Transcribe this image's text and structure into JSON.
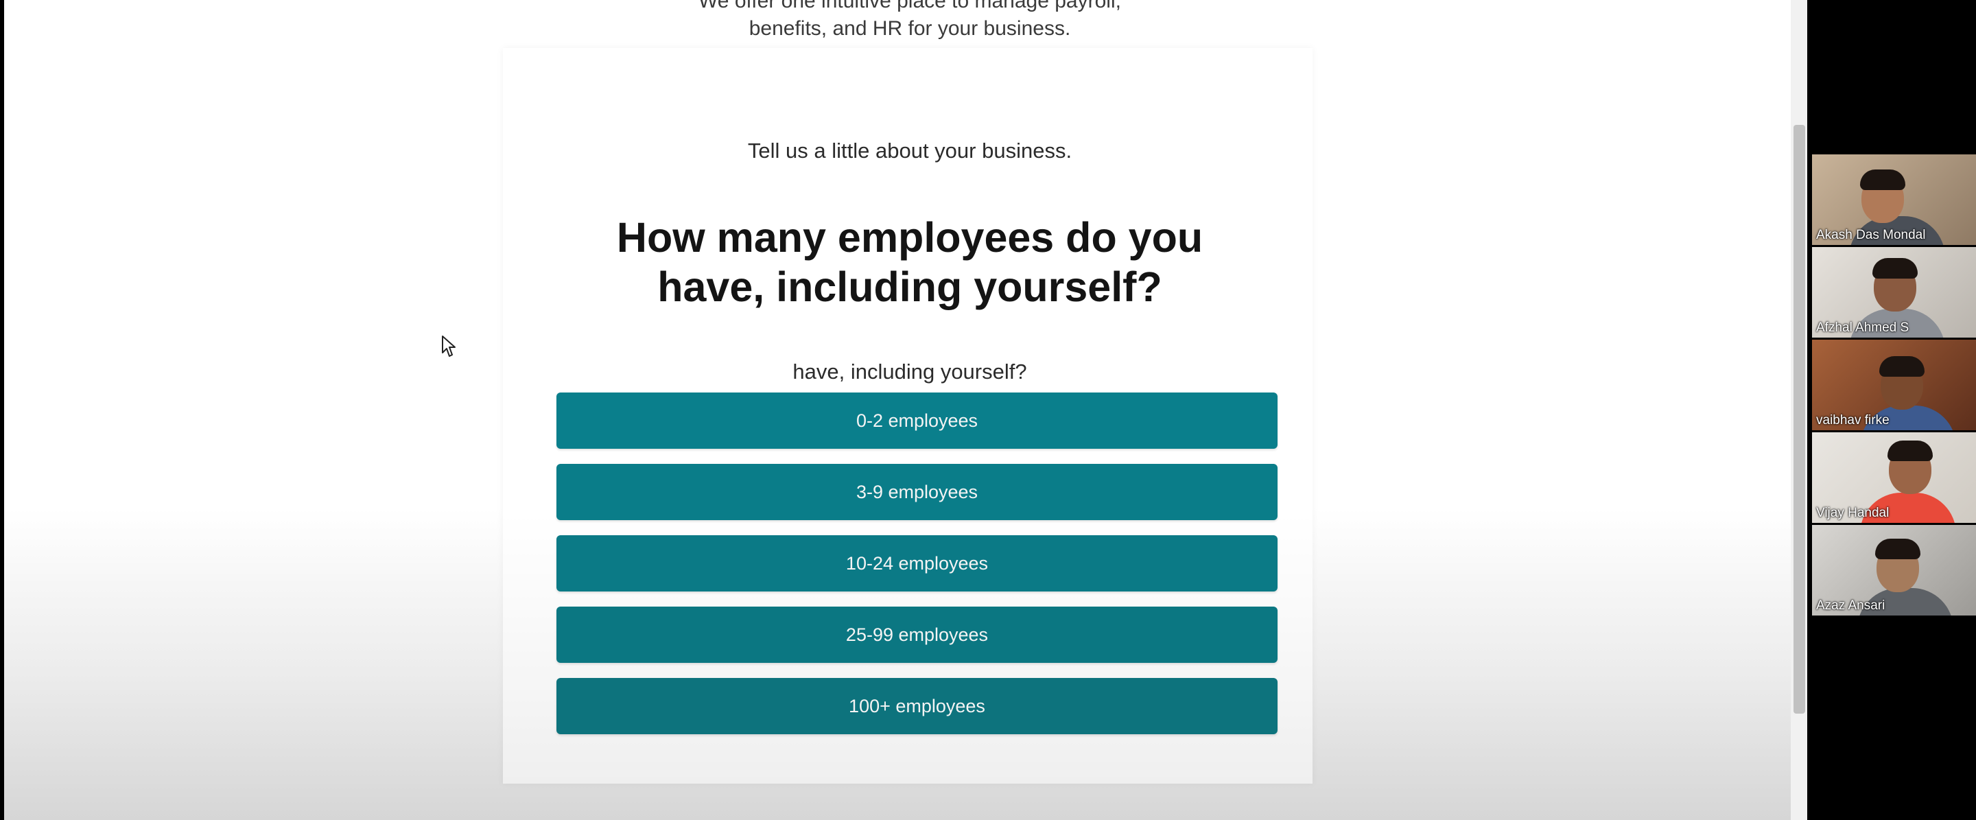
{
  "page": {
    "intro_line1": "We offer one intuitive place to manage payroll,",
    "intro_line2": "benefits, and HR for your business.",
    "prompt": "Tell us a little about your business.",
    "question_line1": "How many employees do you",
    "question_line2": "have, including yourself?",
    "subquestion": "have, including yourself?",
    "options": [
      "0-2 employees",
      "3-9 employees",
      "10-24 employees",
      "25-99 employees",
      "100+ employees"
    ],
    "accent_color": "#0a7f8c"
  },
  "meeting": {
    "participants": [
      {
        "name": "Akash Das Mondal"
      },
      {
        "name": "Afzhal Ahmed S"
      },
      {
        "name": "vaibhav firke"
      },
      {
        "name": "Vijay Handal"
      },
      {
        "name": "Azaz Ansari"
      }
    ]
  },
  "icons": {
    "cursor": "mouse-pointer-icon"
  }
}
